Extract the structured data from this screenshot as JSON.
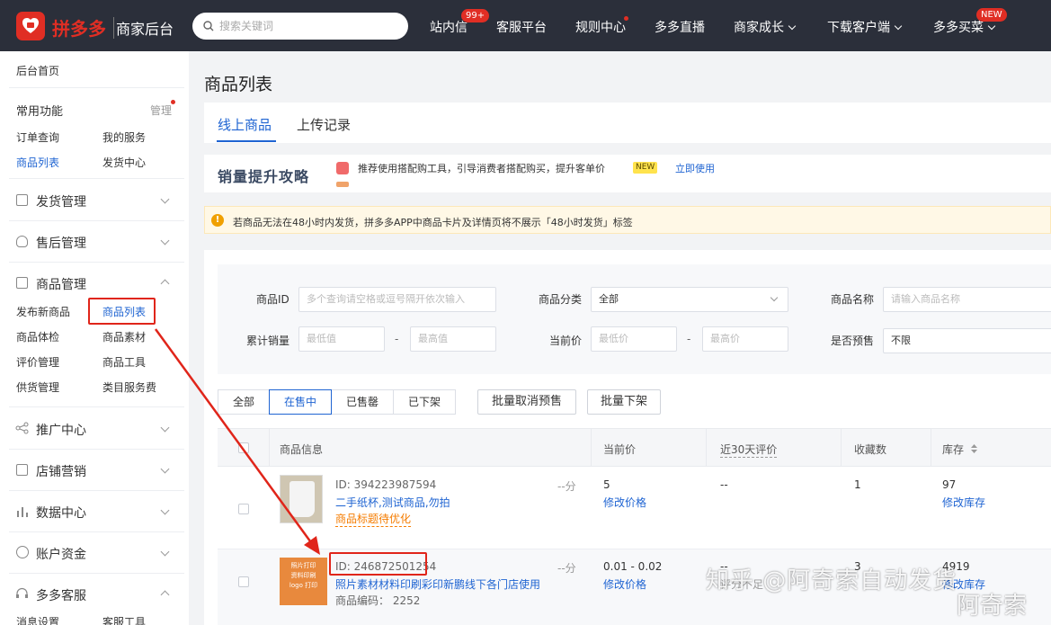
{
  "header": {
    "brand": "拼多多",
    "brand_sub": "商家后台",
    "search_placeholder": "搜索关键词",
    "nav": [
      {
        "label": "站内信",
        "badge": "99+"
      },
      {
        "label": "客服平台"
      },
      {
        "label": "规则中心"
      },
      {
        "label": "多多直播"
      },
      {
        "label": "商家成长"
      },
      {
        "label": "下载客户端"
      },
      {
        "label": "多多买菜",
        "badge": "NEW"
      }
    ]
  },
  "sidebar": {
    "home": "后台首页",
    "common": "常用功能",
    "manage": "管理",
    "common_items": [
      "订单查询",
      "我的服务",
      "商品列表",
      "发货中心"
    ],
    "groups": [
      "发货管理",
      "售后管理",
      "商品管理",
      "推广中心",
      "店铺营销",
      "数据中心",
      "账户资金",
      "多多客服"
    ],
    "goods_items": [
      "发布新商品",
      "商品列表",
      "商品体检",
      "商品素材",
      "评价管理",
      "商品工具",
      "供货管理",
      "类目服务费"
    ],
    "kefu_items": [
      "消息设置",
      "客服工具"
    ]
  },
  "page": {
    "title": "商品列表",
    "tabs": [
      "线上商品",
      "上传记录"
    ]
  },
  "promo": {
    "title": "销量提升攻略",
    "text": "推荐使用搭配购工具，引导消费者搭配购买，提升客单价",
    "tag": "NEW",
    "link": "立即使用"
  },
  "notice": {
    "text": "若商品无法在48小时内发货，拼多多APP中商品卡片及详情页将不展示「48小时发货」标签"
  },
  "filters": {
    "id_label": "商品ID",
    "id_placeholder": "多个查询请空格或逗号隔开依次输入",
    "category_label": "商品分类",
    "category_value": "全部",
    "name_label": "商品名称",
    "name_placeholder": "请输入商品名称",
    "sales_label": "累计销量",
    "min_placeholder": "最低值",
    "max_placeholder": "最高值",
    "price_label": "当前价",
    "min_price_placeholder": "最低价",
    "max_price_placeholder": "最高价",
    "presale_label": "是否预售",
    "presale_value": "不限",
    "dash": "-"
  },
  "status_tabs": [
    "全部",
    "在售中",
    "已售罄",
    "已下架"
  ],
  "actions": [
    "批量取消预售",
    "批量下架"
  ],
  "table": {
    "columns": [
      "商品信息",
      "当前价",
      "近30天评价",
      "收藏数",
      "库存"
    ],
    "rows": [
      {
        "id": "ID: 394223987594",
        "name": "二手纸杯,测试商品,勿拍",
        "tag": "商品标题待优化",
        "score": "--分",
        "price": "5",
        "price_action": "修改价格",
        "review": "--",
        "favorites": "1",
        "stock": "97",
        "stock_action": "修改库存"
      },
      {
        "id": "ID: 246872501254",
        "name": "照片素材材料印刷彩印新鹏线下各门店使用",
        "code": "商品编码： 2252",
        "score": "--分",
        "price": "0.01 - 0.02",
        "price_action": "修改价格",
        "review": "--",
        "review_sub": "评分不足",
        "favorites": "3",
        "stock": "4919",
        "stock_action": "修改库存",
        "thumb_text": [
          "照片打印",
          "资料印刷",
          "logo 打印"
        ]
      }
    ]
  },
  "watermark": {
    "line1": "知乎 @阿奇索自动发货",
    "line2": "阿奇索"
  }
}
